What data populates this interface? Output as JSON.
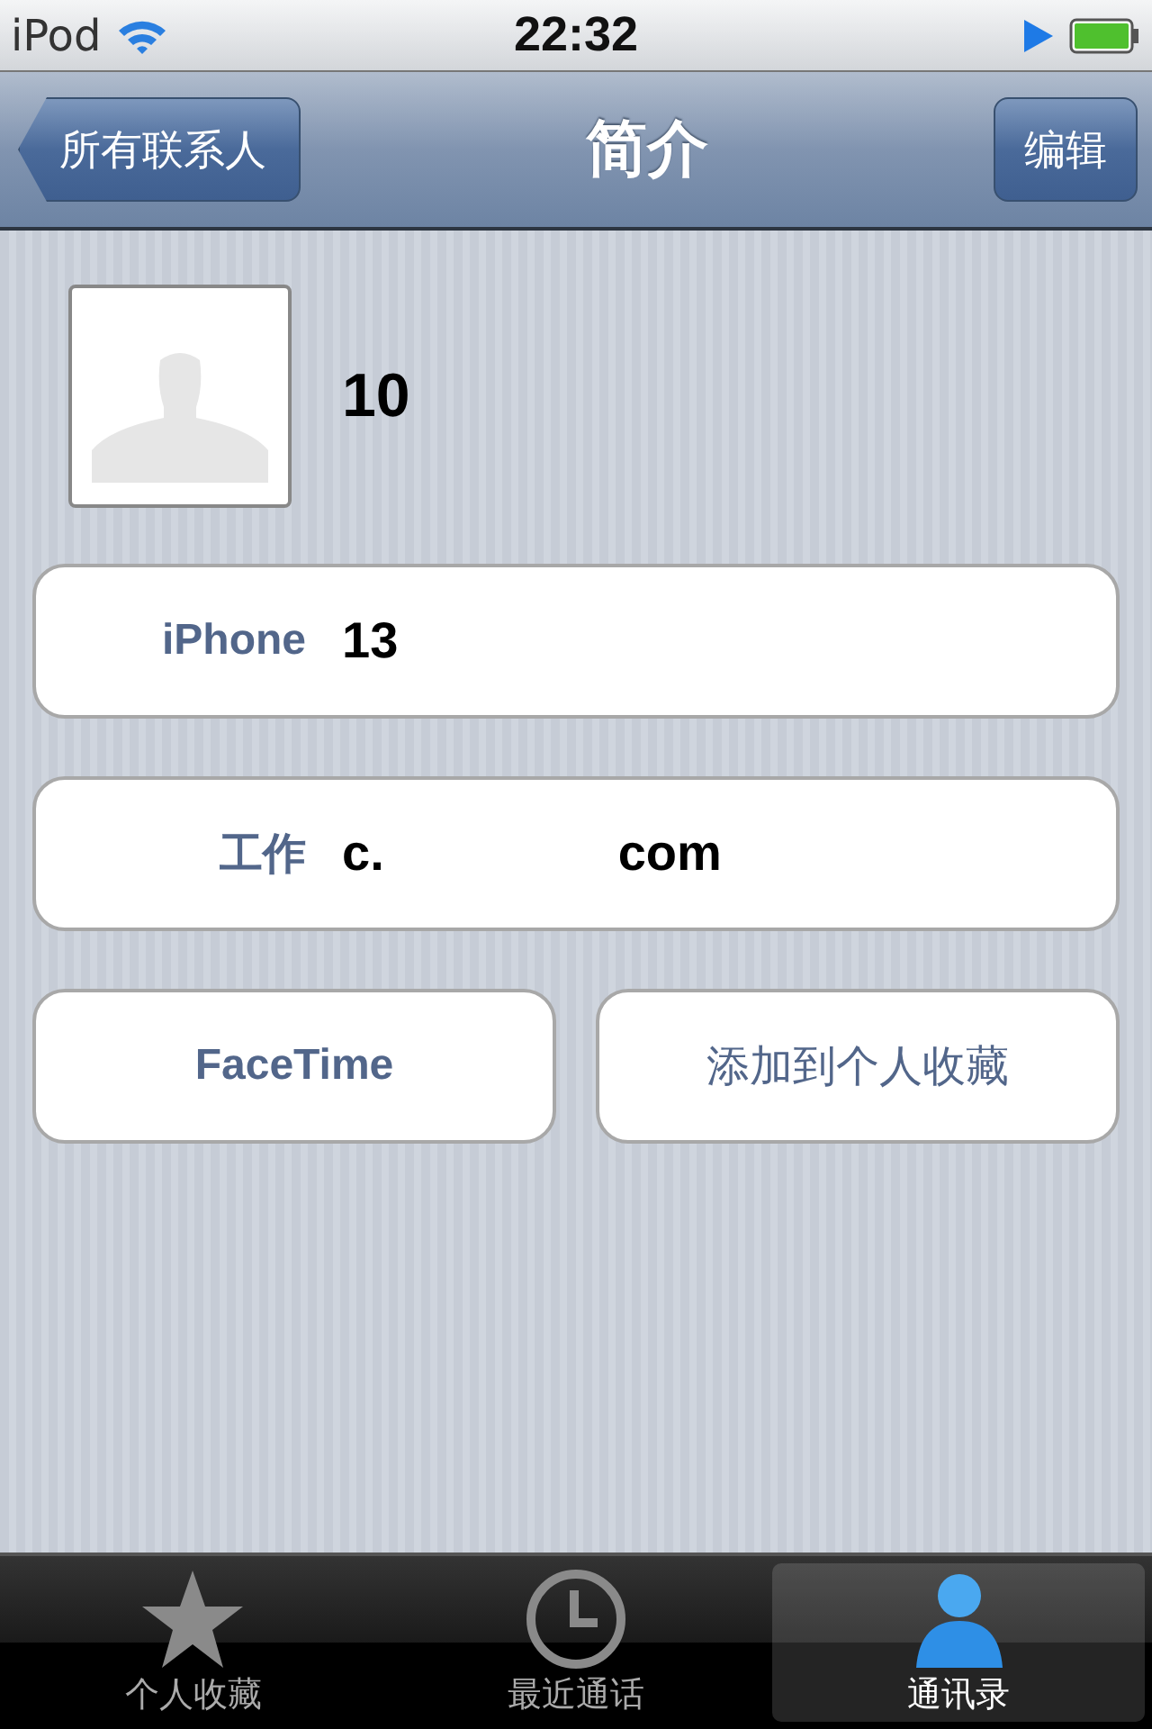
{
  "status_bar": {
    "carrier": "iPod",
    "time": "22:32"
  },
  "nav_bar": {
    "back": "所有联系人",
    "title": "简介",
    "action": "编辑"
  },
  "contact": {
    "name": "10"
  },
  "fields": [
    {
      "label": "iPhone",
      "value_parts": [
        "13"
      ]
    },
    {
      "label": "工作",
      "value_parts": [
        "c.",
        "com"
      ]
    }
  ],
  "buttons": [
    "FaceTime",
    "添加到个人收藏"
  ],
  "tab_bar": [
    {
      "label": "个人收藏",
      "kind": "star",
      "selected": false
    },
    {
      "label": "最近通话",
      "kind": "clock",
      "selected": false
    },
    {
      "label": "通讯录",
      "kind": "person",
      "selected": true
    }
  ]
}
